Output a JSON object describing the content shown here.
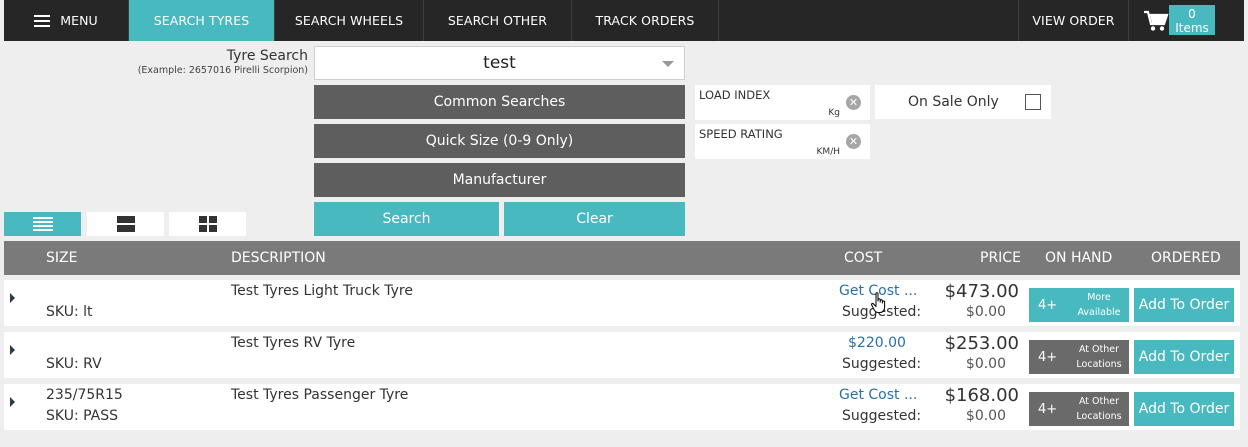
{
  "nav": {
    "menu_label": "MENU",
    "items": [
      {
        "label": "SEARCH TYRES",
        "active": true
      },
      {
        "label": "SEARCH WHEELS",
        "active": false
      },
      {
        "label": "SEARCH OTHER",
        "active": false
      },
      {
        "label": "TRACK ORDERS",
        "active": false
      }
    ],
    "view_order_label": "VIEW ORDER",
    "cart_count": "0",
    "cart_items_label": "Items"
  },
  "search": {
    "label": "Tyre Search",
    "example": "(Example: 2657016 Pirelli Scorpion)",
    "value": "test",
    "common_searches": "Common Searches",
    "quick_size": "Quick Size (0-9 Only)",
    "manufacturer": "Manufacturer",
    "search_button": "Search",
    "clear_button": "Clear"
  },
  "filters": {
    "load_index": {
      "label": "LOAD INDEX",
      "unit": "Kg"
    },
    "speed_rating": {
      "label": "SPEED RATING",
      "unit": "KM/H"
    },
    "on_sale_only": {
      "label": "On Sale Only",
      "checked": false
    }
  },
  "table": {
    "headers": {
      "size": "SIZE",
      "description": "DESCRIPTION",
      "cost": "COST",
      "price": "PRICE",
      "on_hand": "ON HAND",
      "ordered": "ORDERED"
    },
    "rows": [
      {
        "size": "",
        "sku": "SKU: lt",
        "description": "Test Tyres Light Truck Tyre",
        "cost": "Get Cost ...",
        "suggested": "Suggested:",
        "price": "$473.00",
        "price_sub": "$0.00",
        "on_hand_count": "4+",
        "on_hand_note_1": "More",
        "on_hand_note_2": "Available",
        "on_hand_color": "#49b9c0",
        "add_label": "Add To Order"
      },
      {
        "size": "",
        "sku": "SKU: RV",
        "description": "Test Tyres RV Tyre",
        "cost": "$220.00",
        "suggested": "Suggested:",
        "price": "$253.00",
        "price_sub": "$0.00",
        "on_hand_count": "4+",
        "on_hand_note_1": "At Other",
        "on_hand_note_2": "Locations",
        "on_hand_color": "#6a6a6a",
        "add_label": "Add To Order"
      },
      {
        "size": "235/75R15",
        "sku": "SKU: PASS",
        "description": "Test Tyres Passenger Tyre",
        "cost": "Get Cost ...",
        "suggested": "Suggested:",
        "price": "$168.00",
        "price_sub": "$0.00",
        "on_hand_count": "4+",
        "on_hand_note_1": "At Other",
        "on_hand_note_2": "Locations",
        "on_hand_color": "#6a6a6a",
        "add_label": "Add To Order"
      }
    ]
  },
  "colors": {
    "accent": "#49b9c0",
    "nav_bg": "#262626",
    "button_gray": "#5e5e5e",
    "header_gray": "#7a7a7a",
    "link_blue": "#2a6fa8"
  },
  "icons": [
    "hamburger-icon",
    "cart-icon",
    "dropdown-caret-icon",
    "clear-x-icon",
    "checkbox-icon",
    "list-view-icon",
    "row-view-icon",
    "grid-view-icon",
    "expand-arrow-icon",
    "hand-cursor-icon"
  ]
}
